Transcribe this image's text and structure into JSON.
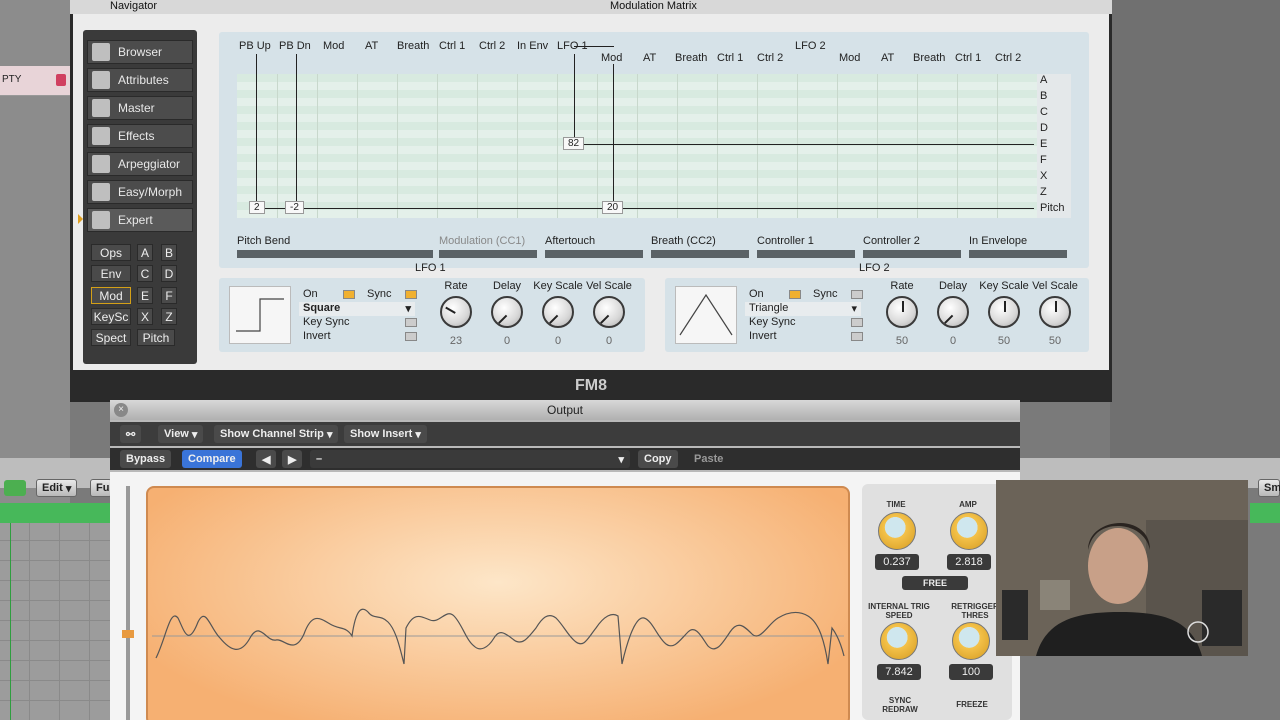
{
  "background": {
    "left_tag": "PTY",
    "edit_label": "Edit",
    "fu_label": "Fu",
    "sma_label": "Sma"
  },
  "fm8": {
    "navigator_title": "Navigator",
    "matrix_title": "Modulation Matrix",
    "app_name": "FM8",
    "nav_items": [
      "Browser",
      "Attributes",
      "Master",
      "Effects",
      "Arpeggiator",
      "Easy/Morph",
      "Expert"
    ],
    "nav_sub": [
      "Ops",
      "A",
      "B",
      "Env",
      "C",
      "D",
      "Mod",
      "E",
      "F",
      "KeySc",
      "X",
      "Z",
      "Spect",
      "Pitch"
    ],
    "sources_row1": [
      "PB Up",
      "PB Dn",
      "Mod",
      "AT",
      "Breath",
      "Ctrl 1",
      "Ctrl 2",
      "In Env",
      "LFO 1",
      "LFO 2"
    ],
    "sources_lfo1": [
      "Mod",
      "AT",
      "Breath",
      "Ctrl 1",
      "Ctrl 2"
    ],
    "sources_lfo2": [
      "Mod",
      "AT",
      "Breath",
      "Ctrl 1",
      "Ctrl 2"
    ],
    "destinations": [
      "A",
      "B",
      "C",
      "D",
      "E",
      "F",
      "X",
      "Z",
      "Pitch"
    ],
    "matrix_values": [
      "2",
      "-2",
      "82",
      "20"
    ],
    "controllers": [
      "Pitch Bend",
      "Modulation (CC1)",
      "Aftertouch",
      "Breath (CC2)",
      "Controller 1",
      "Controller 2",
      "In Envelope"
    ],
    "lfo1": {
      "title": "LFO 1",
      "on": "On",
      "sync": "Sync",
      "wave": "Square",
      "key_sync": "Key Sync",
      "invert": "Invert",
      "knobs": [
        "Rate",
        "Delay",
        "Key Scale",
        "Vel Scale"
      ],
      "values": [
        "23",
        "0",
        "0",
        "0"
      ]
    },
    "lfo2": {
      "title": "LFO 2",
      "on": "On",
      "sync": "Sync",
      "wave": "Triangle",
      "key_sync": "Key Sync",
      "invert": "Invert",
      "knobs": [
        "Rate",
        "Delay",
        "Key Scale",
        "Vel Scale"
      ],
      "values": [
        "50",
        "0",
        "50",
        "50"
      ]
    }
  },
  "output": {
    "title": "Output",
    "view": "View",
    "show_channel_strip": "Show Channel Strip",
    "show_insert": "Show Insert",
    "bypass": "Bypass",
    "compare": "Compare",
    "preset": "–",
    "copy": "Copy",
    "paste": "Paste",
    "time_label": "TIME",
    "amp_label": "AMP",
    "time_value": "0.237",
    "amp_value": "2.818",
    "free": "FREE",
    "internal_trig": "INTERNAL TRIG SPEED",
    "retrigger": "RETRIGGER THRES",
    "trig_value": "7.842",
    "thres_value": "100",
    "sync_redraw": "SYNC REDRAW",
    "freeze": "FREEZE"
  }
}
